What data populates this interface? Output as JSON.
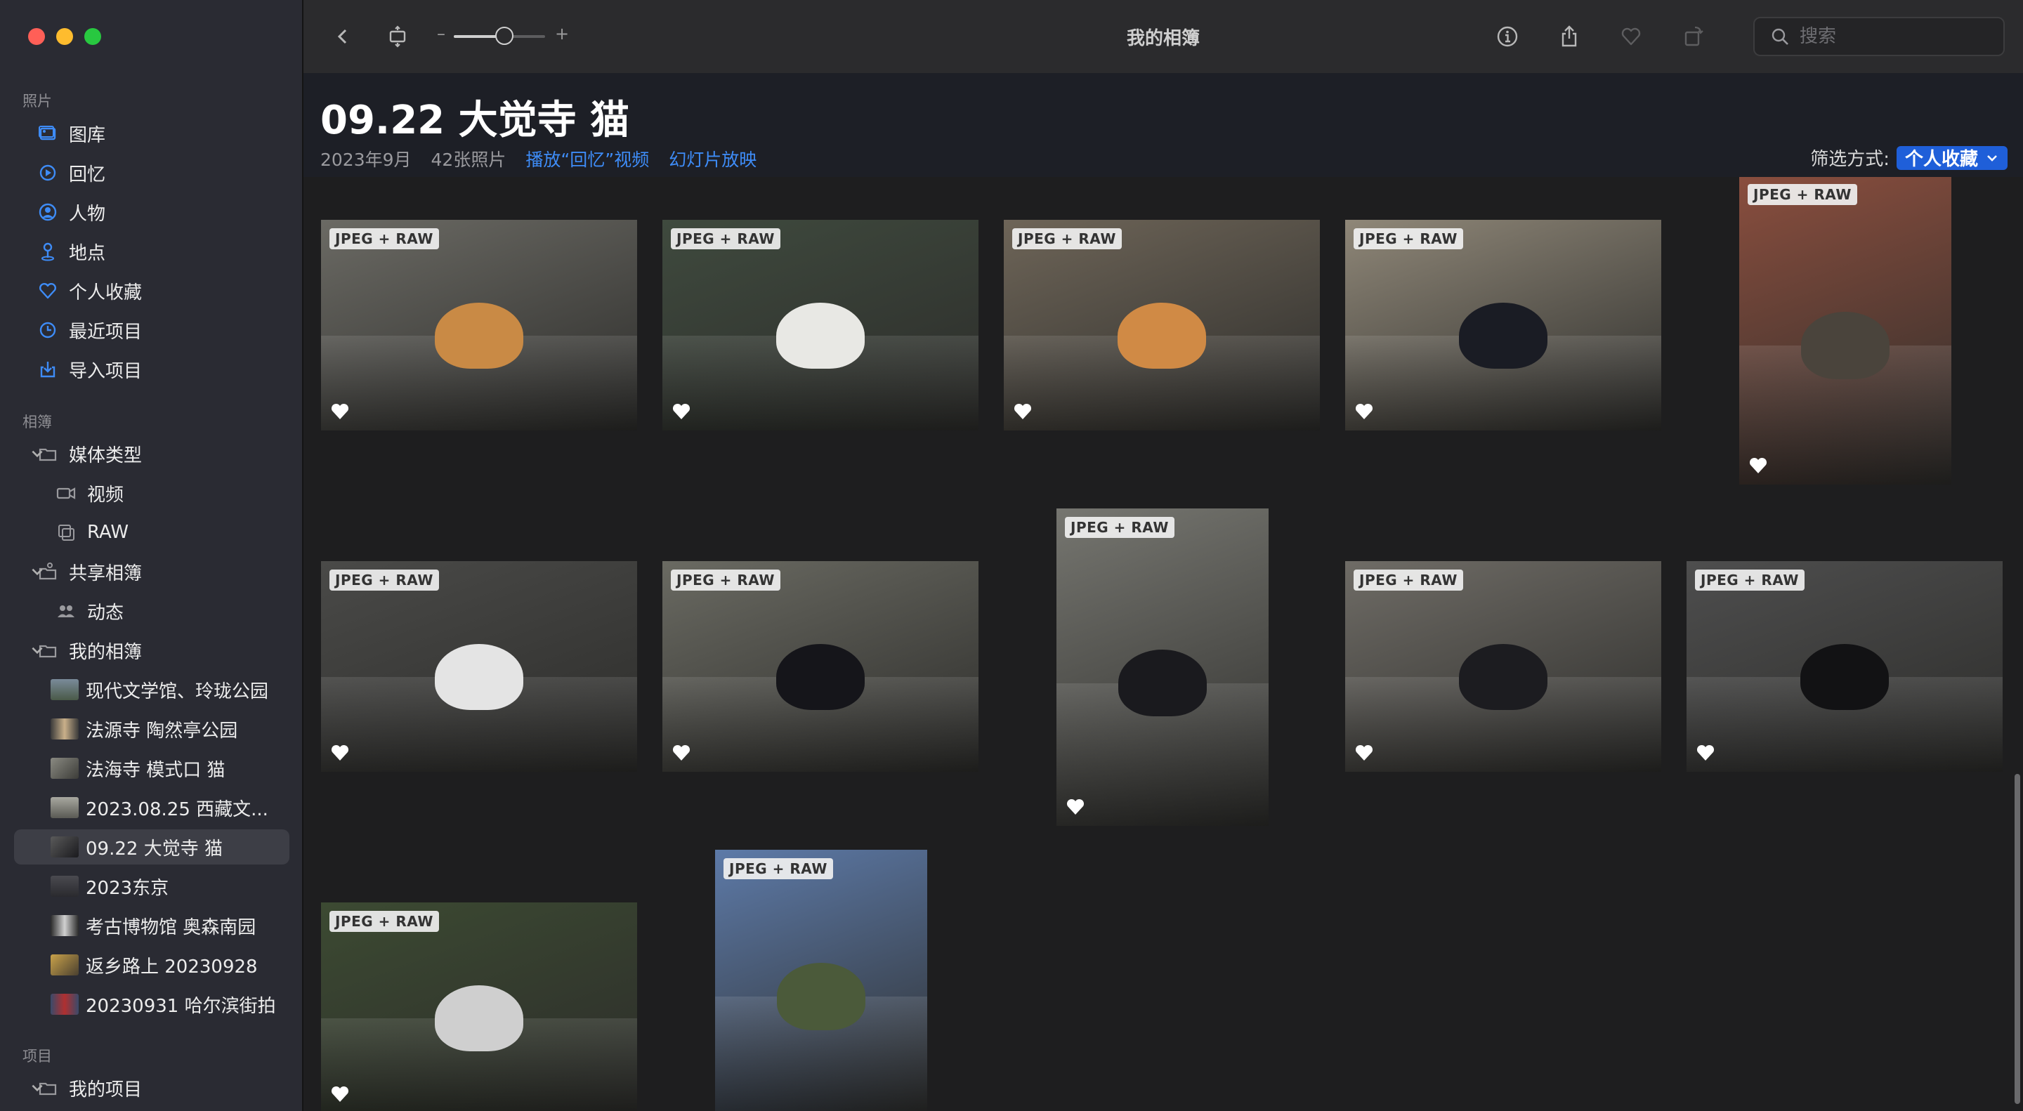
{
  "window": {
    "title": "我的相簿"
  },
  "toolbar": {
    "zoom_minus": "–",
    "zoom_plus": "+",
    "zoom_level": 0.55
  },
  "search": {
    "placeholder": "搜索"
  },
  "sidebar": {
    "photos_section": "照片",
    "photos_items": [
      {
        "label": "图库",
        "icon": "library-icon"
      },
      {
        "label": "回忆",
        "icon": "memories-icon"
      },
      {
        "label": "人物",
        "icon": "people-icon"
      },
      {
        "label": "地点",
        "icon": "places-icon"
      },
      {
        "label": "个人收藏",
        "icon": "heart-icon"
      },
      {
        "label": "最近项目",
        "icon": "clock-icon"
      },
      {
        "label": "导入项目",
        "icon": "import-icon"
      }
    ],
    "albums_section": "相簿",
    "media_types": "媒体类型",
    "media_video": "视频",
    "media_raw": "RAW",
    "shared_albums": "共享相簿",
    "shared_activity": "动态",
    "my_albums": "我的相簿",
    "album_list": [
      "现代文学馆、玲珑公园",
      "法源寺 陶然亭公园",
      "法海寺 模式口 猫",
      "2023.08.25 西藏文...",
      "09.22 大觉寺 猫",
      "2023东京",
      "考古博物馆 奥森南园",
      "返乡路上 20230928",
      "20230931 哈尔滨街拍"
    ],
    "selected_album_index": 4,
    "projects_section": "项目",
    "my_projects": "我的项目"
  },
  "header": {
    "album_title": "09.22 大觉寺 猫",
    "date": "2023年9月",
    "count": "42张照片",
    "play_memory": "播放“回忆”视频",
    "slideshow": "幻灯片放映",
    "filter_label": "筛选方式:",
    "filter_value": "个人收藏"
  },
  "photos": [
    {
      "badge": "JPEG + RAW",
      "favorite": true,
      "scene": "orange cat lying on rocks",
      "bg": "#6b6a64",
      "cat": "#c98a45"
    },
    {
      "badge": "JPEG + RAW",
      "favorite": true,
      "scene": "white cat sitting",
      "bg": "#3f4a3e",
      "cat": "#e8e8e4"
    },
    {
      "badge": "JPEG + RAW",
      "favorite": true,
      "scene": "orange and white cat sitting",
      "bg": "#6e6558",
      "cat": "#d08a45"
    },
    {
      "badge": "JPEG + RAW",
      "favorite": true,
      "scene": "black and white cat lying",
      "bg": "#8f8778",
      "cat": "#1a1c24"
    },
    {
      "badge": "JPEG + RAW",
      "favorite": true,
      "scene": "long-haired tabby cat",
      "bg": "#8a4e3e",
      "cat": "#4a443c"
    },
    {
      "badge": "JPEG + RAW",
      "favorite": true,
      "scene": "tuxedo cat on rocks",
      "bg": "#4a4a48",
      "cat": "#e4e4e4"
    },
    {
      "badge": "JPEG + RAW",
      "favorite": true,
      "scene": "black cat lying on rock",
      "bg": "#6a6a62",
      "cat": "#15151a"
    },
    {
      "badge": "JPEG + RAW",
      "favorite": true,
      "scene": "tuxedo cat sitting on rock",
      "bg": "#767670",
      "cat": "#1a1a1e"
    },
    {
      "badge": "JPEG + RAW",
      "favorite": true,
      "scene": "tuxedo cat on stone",
      "bg": "#6f6c66",
      "cat": "#1c1c20"
    },
    {
      "badge": "JPEG + RAW",
      "favorite": true,
      "scene": "tuxedo cat walking",
      "bg": "#4e4e4e",
      "cat": "#121214"
    },
    {
      "badge": "JPEG + RAW",
      "favorite": true,
      "scene": "cat under bushes",
      "bg": "#3c4a32",
      "cat": "#cfcfcf"
    },
    {
      "badge": "JPEG + RAW",
      "favorite": false,
      "scene": "railway and mountains",
      "bg": "#5d7aa8",
      "cat": "#4b5a3a"
    }
  ],
  "colors": {
    "accent": "#3e8cf7",
    "filter_bg": "#1f5fd9",
    "sidebar_bg": "#2a2b33"
  }
}
